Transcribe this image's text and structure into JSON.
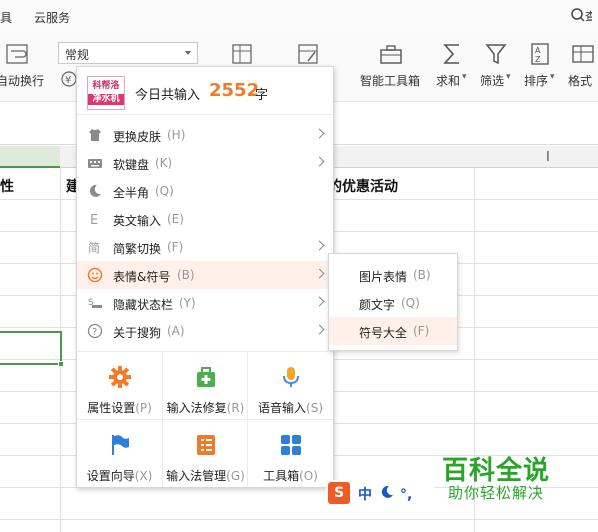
{
  "menubar": {
    "items": [
      "具",
      "云服务"
    ]
  },
  "ribbon": {
    "wrap_label": "自动换行",
    "format_select": "常规",
    "tools": [
      "智能工具箱",
      "求和",
      "筛选",
      "排序",
      "格式"
    ]
  },
  "sheet": {
    "cell_a": "性",
    "cell_b": "建",
    "cell_c": "的优惠活动"
  },
  "ime": {
    "count_prefix": "今日共输入",
    "count_value": "2552",
    "count_suffix": "字",
    "logo_line1": "科帮洛",
    "logo_line2": "净水机",
    "menu": [
      {
        "label": "更换皮肤",
        "shortcut": "(H)",
        "has_sub": true,
        "icon": "shirt-icon"
      },
      {
        "label": "软键盘",
        "shortcut": "(K)",
        "has_sub": true,
        "icon": "keyboard-icon"
      },
      {
        "label": "全半角",
        "shortcut": "(Q)",
        "has_sub": false,
        "icon": "half-moon-icon"
      },
      {
        "label": "英文输入",
        "shortcut": "(E)",
        "has_sub": false,
        "icon": "english-e-icon"
      },
      {
        "label": "简繁切换",
        "shortcut": "(F)",
        "has_sub": true,
        "icon": "traditional-char-icon"
      },
      {
        "label": "表情&符号",
        "shortcut": "(B)",
        "has_sub": true,
        "icon": "smiley-icon",
        "highlighted": true
      },
      {
        "label": "隐藏状态栏",
        "shortcut": "(Y)",
        "has_sub": true,
        "icon": "hide-bar-icon"
      },
      {
        "label": "关于搜狗",
        "shortcut": "(A)",
        "has_sub": true,
        "icon": "question-icon"
      }
    ],
    "tools": [
      {
        "label": "属性设置",
        "key": "(P)",
        "icon": "gear-icon"
      },
      {
        "label": "输入法修复",
        "key": "(R)",
        "icon": "repair-kit-icon"
      },
      {
        "label": "语音输入",
        "key": "(S)",
        "icon": "microphone-icon"
      },
      {
        "label": "设置向导",
        "key": "(X)",
        "icon": "flag-icon"
      },
      {
        "label": "输入法管理",
        "key": "(G)",
        "icon": "manage-icon"
      },
      {
        "label": "工具箱",
        "key": "(O)",
        "icon": "grid-icon"
      }
    ],
    "submenu": [
      {
        "label": "图片表情",
        "shortcut": "(B)"
      },
      {
        "label": "颜文字",
        "shortcut": "(Q)"
      },
      {
        "label": "符号大全",
        "shortcut": "(F)",
        "highlighted": true
      }
    ],
    "statusbar": {
      "mode": "中",
      "punct": "°,"
    }
  },
  "watermark": {
    "title": "百科全说",
    "subtitle": "助你轻松解决"
  },
  "colors": {
    "accent": "#f07c2b",
    "grid_select": "#4a9a4a",
    "ime_blue": "#1a57c8",
    "ime_orange": "#f05a23",
    "watermark": "#2aa52a"
  }
}
